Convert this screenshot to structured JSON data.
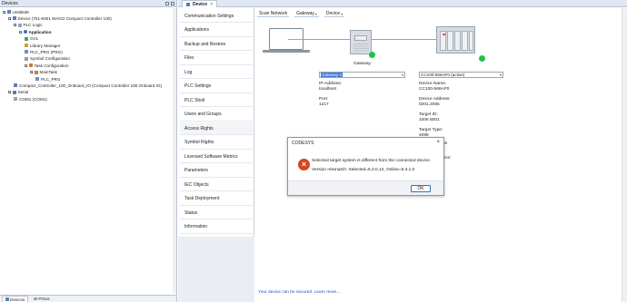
{
  "devices_pane": {
    "title": "Devices",
    "tree": [
      {
        "label": "Untitled9",
        "level": 0,
        "icon": "project-icon",
        "bold": false
      },
      {
        "label": "Device (751-9301 WAGO Compact Controller 100)",
        "level": 1,
        "icon": "device-icon",
        "bold": false
      },
      {
        "label": "PLC Logic",
        "level": 2,
        "icon": "plc-logic-icon",
        "bold": false
      },
      {
        "label": "Application",
        "level": 3,
        "icon": "application-icon",
        "bold": true
      },
      {
        "label": "GVL",
        "level": 4,
        "icon": "gvl-icon",
        "bold": false
      },
      {
        "label": "Library Manager",
        "level": 4,
        "icon": "library-icon",
        "bold": false
      },
      {
        "label": "PLC_PRG (PRG)",
        "level": 4,
        "icon": "program-icon",
        "bold": false
      },
      {
        "label": "Symbol Configuration",
        "level": 4,
        "icon": "symbol-icon",
        "bold": false
      },
      {
        "label": "Task Configuration",
        "level": 4,
        "icon": "task-config-icon",
        "bold": false
      },
      {
        "label": "MainTask",
        "level": 5,
        "icon": "task-icon",
        "bold": false
      },
      {
        "label": "PLC_PRG",
        "level": 6,
        "icon": "program-icon",
        "bold": false
      },
      {
        "label": "Compact_Controller_100_Onboard_IO (Compact Controller 100 Onboard IO)",
        "level": 2,
        "icon": "io-icon",
        "bold": false
      },
      {
        "label": "Serial",
        "level": 1,
        "icon": "serial-icon",
        "bold": false
      },
      {
        "label": "COM1 (COM1)",
        "level": 2,
        "icon": "com-port-icon",
        "bold": false
      }
    ],
    "footer_tabs": [
      {
        "label": "Devices",
        "active": true
      },
      {
        "label": "POUs",
        "active": false
      }
    ]
  },
  "editor": {
    "tab_title": "Device",
    "tab_close": "×",
    "nav_items": [
      {
        "label": "Communication Settings",
        "active": false
      },
      {
        "label": "Applications",
        "active": false
      },
      {
        "label": "Backup and Restore",
        "active": false
      },
      {
        "label": "Files",
        "active": false
      },
      {
        "label": "Log",
        "active": false
      },
      {
        "label": "PLC Settings",
        "active": false
      },
      {
        "label": "PLC Shell",
        "active": false
      },
      {
        "label": "Users and Groups",
        "active": false
      },
      {
        "label": "Access Rights",
        "active": true
      },
      {
        "label": "Symbol Rights",
        "active": false
      },
      {
        "label": "Licensed Software Metrics",
        "active": false
      },
      {
        "label": "Parameters",
        "active": false
      },
      {
        "label": "IEC Objects",
        "active": false
      },
      {
        "label": "Task Deployment",
        "active": false
      },
      {
        "label": "Status",
        "active": false
      },
      {
        "label": "Information",
        "active": false
      }
    ],
    "scan_bar": {
      "scan_network": "Scan Network",
      "gateway": "Gateway",
      "device": "Device"
    },
    "gateway": {
      "label": "Gateway",
      "combo_value": "Gateway-1",
      "ip_label": "IP-Address:",
      "ip_value": "localhost",
      "port_label": "Port:",
      "port_value": "1217"
    },
    "device": {
      "combo_value": "CC100-566AF0 (active)",
      "name_label": "Device Name:",
      "name_value": "CC100-566AF0",
      "address_label": "Device Address:",
      "address_value": "0201.2065",
      "target_id_label": "Target ID:",
      "target_id_value": "1006 5001",
      "target_type_label": "Target Type:",
      "target_type_value": "4096",
      "partial_1": "on",
      "partial_2": "ion:"
    },
    "status_color": "#20c24b",
    "bottom_link": "Your device can be secured. Learn more..."
  },
  "dialog": {
    "title": "CODESYS",
    "close": "×",
    "icon": "error-icon",
    "icon_glyph": "×",
    "message_line1": "Selected target system is different from the connected device.",
    "message_line2": "Version mismatch: Selected=6.3.0.12, Online=6.3.1.0",
    "ok_label": "OK",
    "accent": "#3a6fc6",
    "error_color": "#d6451f"
  }
}
